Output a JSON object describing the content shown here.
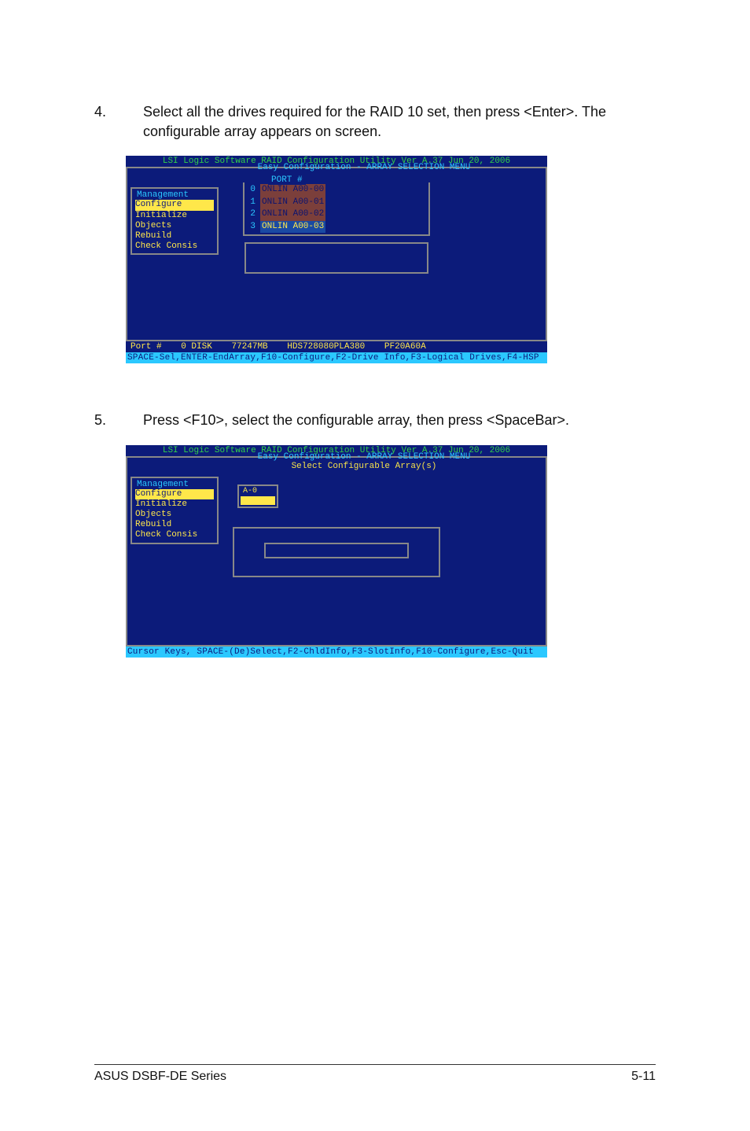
{
  "steps": {
    "s4": {
      "num": "4.",
      "text": "Select all the drives required for the RAID 10 set, then press <Enter>. The configurable array appears on screen."
    },
    "s5": {
      "num": "5.",
      "text": "Press <F10>, select the configurable array, then press <SpaceBar>."
    }
  },
  "bios1": {
    "title": "LSI Logic Software RAID Configuration Utility Ver A.37 Jun 20, 2006",
    "section": "Easy Configuration - ARRAY SELECTION MENU",
    "mgmt_title": "Management",
    "mgmt": [
      "Configure",
      "Initialize",
      "Objects",
      "Rebuild",
      "Check Consis"
    ],
    "port_header": "PORT #",
    "drives": [
      {
        "id": "0",
        "txt": "ONLIN A00-00"
      },
      {
        "id": "1",
        "txt": "ONLIN A00-01"
      },
      {
        "id": "2",
        "txt": "ONLIN A00-02"
      },
      {
        "id": "3",
        "txt": "ONLIN A00-03"
      }
    ],
    "status": {
      "port": "Port #",
      "slot": "0 DISK",
      "size": "77247MB",
      "model": "HDS728080PLA380",
      "serial": "PF20A60A"
    },
    "footer": "SPACE-Sel,ENTER-EndArray,F10-Configure,F2-Drive Info,F3-Logical Drives,F4-HSP"
  },
  "bios2": {
    "title": "LSI Logic Software RAID Configuration Utility Ver A.37 Jun 20, 2006",
    "section_top": "Easy Configuration - ARRAY SELECTION MENU",
    "section_sub": "Select Configurable Array(s)",
    "mgmt_title": "Management",
    "mgmt": [
      "Configure",
      "Initialize",
      "Objects",
      "Rebuild",
      "Check Consis"
    ],
    "array_label": "A-0",
    "footer": "Cursor Keys, SPACE-(De)Select,F2-ChldInfo,F3-SlotInfo,F10-Configure,Esc-Quit"
  },
  "footer": {
    "left": "ASUS DSBF-DE Series",
    "right": "5-11"
  }
}
